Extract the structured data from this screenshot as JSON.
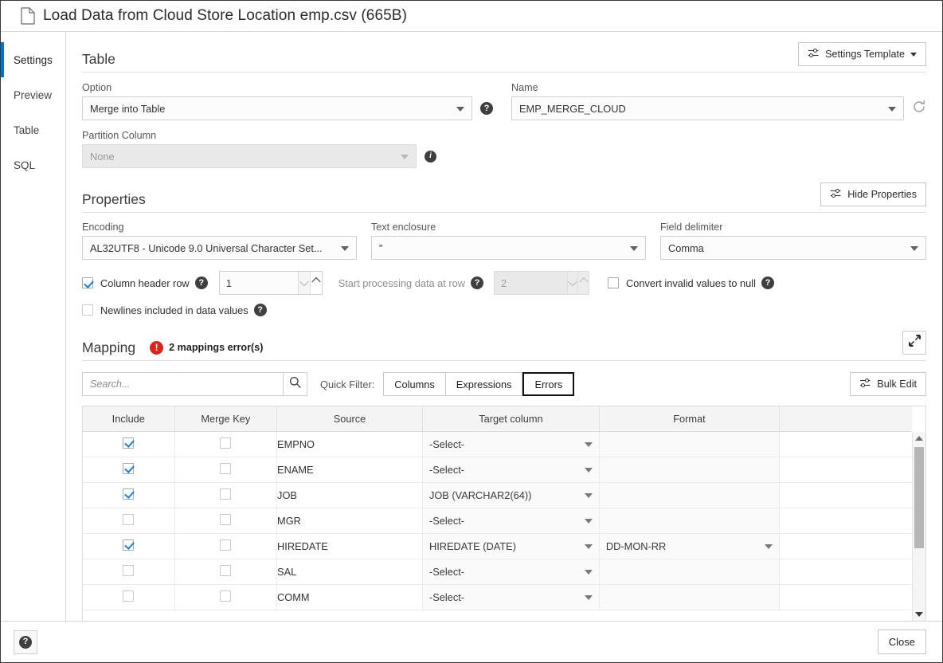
{
  "window": {
    "title": "Load Data from Cloud Store Location emp.csv (665B)",
    "doc_icon": "document-icon"
  },
  "sidebar": {
    "items": [
      {
        "label": "Settings",
        "active": true
      },
      {
        "label": "Preview",
        "active": false
      },
      {
        "label": "Table",
        "active": false
      },
      {
        "label": "SQL",
        "active": false
      }
    ]
  },
  "table_section": {
    "title": "Table",
    "settings_template_button": "Settings Template",
    "option_label": "Option",
    "option_value": "Merge into Table",
    "name_label": "Name",
    "name_value": "EMP_MERGE_CLOUD",
    "partition_label": "Partition Column",
    "partition_value": "None",
    "help_glyph": "?",
    "info_glyph": "i"
  },
  "properties_section": {
    "title": "Properties",
    "hide_properties_button": "Hide Properties",
    "encoding_label": "Encoding",
    "encoding_value": "AL32UTF8 - Unicode 9.0 Universal Character Set...",
    "text_enclosure_label": "Text enclosure",
    "text_enclosure_value": "\"",
    "field_delimiter_label": "Field delimiter",
    "field_delimiter_value": "Comma",
    "column_header_row_label": "Column header row",
    "column_header_row_checked": true,
    "column_header_row_value": "1",
    "start_processing_label": "Start processing data at row",
    "start_processing_value": "2",
    "start_processing_disabled": true,
    "convert_invalid_label": "Convert invalid values to null",
    "convert_invalid_checked": false,
    "newlines_label": "Newlines included in data values",
    "newlines_checked": false
  },
  "mapping_section": {
    "title": "Mapping",
    "error_text": "2 mappings error(s)",
    "error_glyph": "!",
    "expand_icon": "expand-diagonal-icon",
    "search_placeholder": "Search...",
    "search_value": "",
    "quick_filter_label": "Quick Filter:",
    "filters": [
      {
        "label": "Columns",
        "active": false
      },
      {
        "label": "Expressions",
        "active": false
      },
      {
        "label": "Errors",
        "active": true
      }
    ],
    "bulk_edit_button": "Bulk Edit",
    "columns": [
      "Include",
      "Merge Key",
      "Source",
      "Target column",
      "Format",
      ""
    ],
    "rows": [
      {
        "include": true,
        "merge_key": false,
        "source": "EMPNO",
        "target": "-Select-",
        "target_error": true,
        "format": ""
      },
      {
        "include": true,
        "merge_key": false,
        "source": "ENAME",
        "target": "-Select-",
        "target_error": true,
        "format": ""
      },
      {
        "include": true,
        "merge_key": false,
        "source": "JOB",
        "target": "JOB (VARCHAR2(64))",
        "target_error": false,
        "format": ""
      },
      {
        "include": false,
        "merge_key": false,
        "source": "MGR",
        "target": "-Select-",
        "target_error": false,
        "format": ""
      },
      {
        "include": true,
        "merge_key": false,
        "source": "HIREDATE",
        "target": "HIREDATE (DATE)",
        "target_error": false,
        "format": "DD-MON-RR"
      },
      {
        "include": false,
        "merge_key": false,
        "source": "SAL",
        "target": "-Select-",
        "target_error": false,
        "format": ""
      },
      {
        "include": false,
        "merge_key": false,
        "source": "COMM",
        "target": "-Select-",
        "target_error": false,
        "format": ""
      }
    ]
  },
  "footer": {
    "help_glyph": "?",
    "close_button": "Close"
  },
  "colors": {
    "accent": "#0572ce",
    "error": "#d9251d",
    "error_border": "#e00000",
    "checkbox_check": "#1a7fd4"
  }
}
